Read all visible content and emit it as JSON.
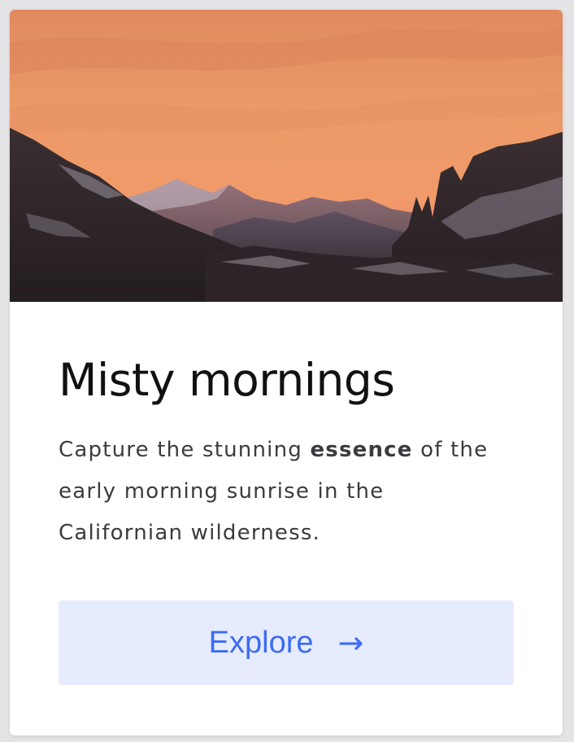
{
  "card": {
    "image_alt": "Mountain ridges under an orange sunrise sky",
    "title": "Misty mornings",
    "description": {
      "before": "Capture the stunning ",
      "emphasis": "essence",
      "after": " of the early morning sunrise in the Californian wilderness."
    },
    "button": {
      "label": "Explore",
      "icon": "arrow-right-icon",
      "arrow": "→"
    }
  },
  "colors": {
    "button_background": "#e6ebfd",
    "button_text": "#3c6cf2",
    "title": "#111114",
    "body_text": "#3b3b40"
  }
}
